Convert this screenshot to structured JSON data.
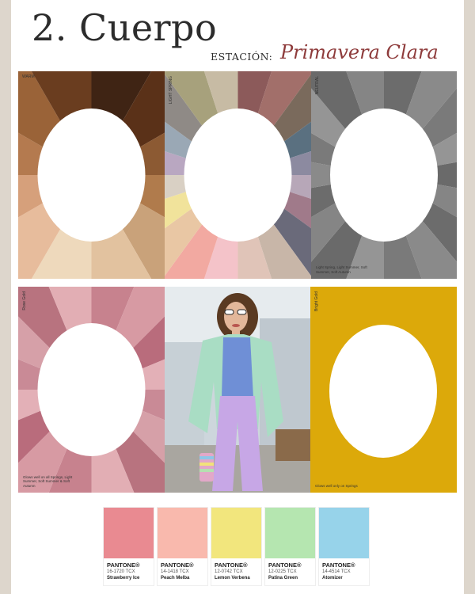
{
  "header": {
    "title": "2. Cuerpo",
    "estacion_label": "ESTACIÓN:",
    "season": "Primavera Clara"
  },
  "cards": {
    "warm": {
      "label": "WARM",
      "colors": [
        "#3f2414",
        "#5a3118",
        "#8c5a33",
        "#b07b4c",
        "#c9a27a",
        "#e2c29f",
        "#eed9bc",
        "#e7bc9c",
        "#d6a07b",
        "#b47a4f",
        "#9a6338",
        "#6a3d1f"
      ]
    },
    "light_spring": {
      "label": "LIGHT SPRING",
      "colors": [
        "#8c5a5a",
        "#a26f6a",
        "#7a6a5c",
        "#5a7080",
        "#8c8aa0",
        "#b7a7b8",
        "#a07a8a",
        "#6a6a7a",
        "#c8b6a8",
        "#e0c4b8",
        "#f4c3c9",
        "#f2a9a1",
        "#e9c7a4",
        "#f1e39b",
        "#d9d0c4",
        "#b9a7c1",
        "#9aa8b5",
        "#8f8a86",
        "#a7a17c",
        "#c7bba4"
      ]
    },
    "neutral": {
      "label": "NEUTRAL",
      "colors": [
        "#6c6c6c",
        "#8a8a8a",
        "#7a7a7a",
        "#959595",
        "#6a6a6a",
        "#858585"
      ],
      "caption": "Light Spring, Light Summer, Soft Summer, Soft Autumn"
    },
    "rose": {
      "label": "Rose Gold",
      "colors": [
        "#c7828e",
        "#d79aa3",
        "#b96c7c",
        "#e3b0b7",
        "#c98a96",
        "#d6a0a8",
        "#b8737f",
        "#e2aeb4"
      ],
      "caption": "Glows well on all Springs, Light Summer, Soft Summer & Soft Autumn"
    },
    "gold": {
      "label": "Bright Gold",
      "color": "#dca90a",
      "caption": "Glows well only on Springs"
    }
  },
  "photo": {
    "alt": "woman in mint blazer and lilac trousers",
    "icon": "person-photo"
  },
  "palette": [
    {
      "brand": "PANTONE®",
      "code": "16-1720 TCX",
      "name": "Strawberry Ice",
      "color": "#e98a91"
    },
    {
      "brand": "PANTONE®",
      "code": "14-1418 TCX",
      "name": "Peach Melba",
      "color": "#f9b9ad"
    },
    {
      "brand": "PANTONE®",
      "code": "12-0742 TCX",
      "name": "Lemon Verbena",
      "color": "#f2e67d"
    },
    {
      "brand": "PANTONE®",
      "code": "12-0225 TCX",
      "name": "Patina Green",
      "color": "#b5e6b0"
    },
    {
      "brand": "PANTONE®",
      "code": "14-4514 TCX",
      "name": "Atomizer",
      "color": "#97d3ea"
    }
  ]
}
